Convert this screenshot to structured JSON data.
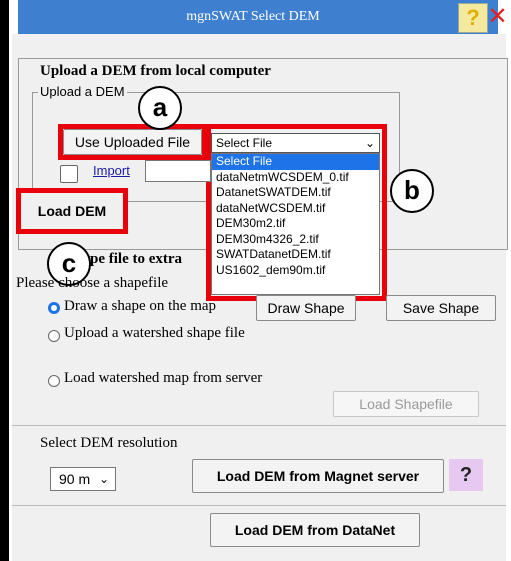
{
  "window": {
    "title": "mgnSWAT Select DEM",
    "help_label": "?",
    "close_label": "✕"
  },
  "upload_section": {
    "title": "Upload a DEM from local computer",
    "legend": "Upload a DEM",
    "use_uploaded_label": "Use Uploaded File",
    "select_value": "Select File",
    "select_options": [
      "Select File",
      "dataNetmWCSDEM_0.tif",
      "DatanetSWATDEM.tif",
      "dataNetWCSDEM.tif",
      "DEM30m2.tif",
      "DEM30m4326_2.tif",
      "SWATDatanetDEM.tif",
      "US1602_dem90m.tif"
    ],
    "import_label": "Import",
    "load_dem_label": "Load DEM"
  },
  "annotations": {
    "a": "a",
    "b": "b",
    "c": "c"
  },
  "shape_section": {
    "title": "pe file to extra",
    "prompt": "Please choose a shapefile",
    "radio_draw": "Draw a shape on the map",
    "draw_shape_label": "Draw Shape",
    "save_shape_label": "Save Shape",
    "radio_upload": "Upload a watershed shape file",
    "radio_server": "Load watershed map from server",
    "load_shapefile_label": "Load Shapefile"
  },
  "resolution": {
    "label": "Select DEM resolution",
    "value": "90 m",
    "load_magnet_label": "Load DEM from Magnet server",
    "help_label": "?",
    "load_datanet_label": "Load DEM from DataNet"
  },
  "colors": {
    "annotation_red": "#e8000a",
    "title_blue": "#3f7fd0",
    "selection_blue": "#1e73e8"
  }
}
